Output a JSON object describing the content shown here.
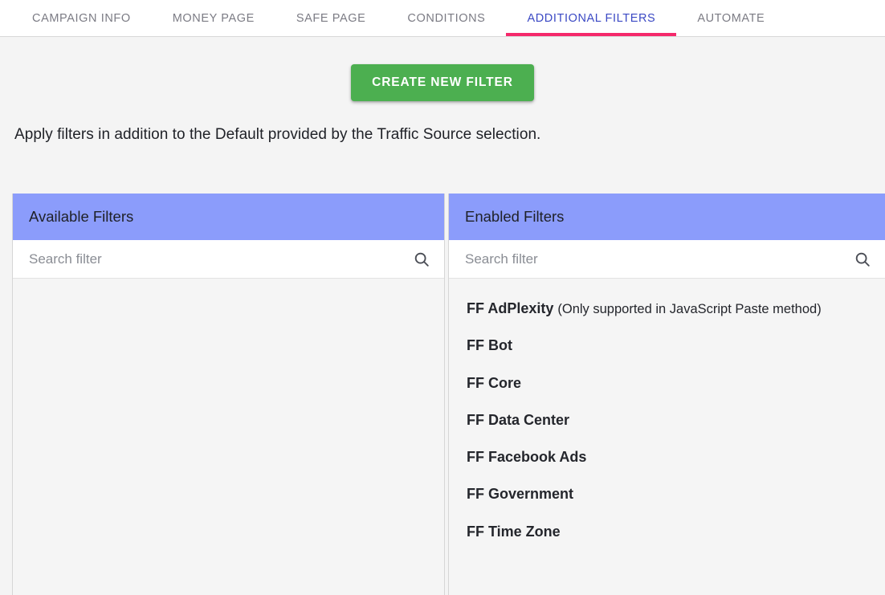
{
  "tabs": [
    {
      "label": "CAMPAIGN INFO",
      "active": false
    },
    {
      "label": "MONEY PAGE",
      "active": false
    },
    {
      "label": "SAFE PAGE",
      "active": false
    },
    {
      "label": "CONDITIONS",
      "active": false
    },
    {
      "label": "ADDITIONAL FILTERS",
      "active": true
    },
    {
      "label": "AUTOMATE",
      "active": false
    }
  ],
  "toolbar": {
    "create_filter_label": "CREATE NEW FILTER"
  },
  "description": "Apply filters in addition to the Default provided by the Traffic Source selection.",
  "panels": {
    "available": {
      "title": "Available Filters",
      "search_placeholder": "Search filter",
      "search_value": "",
      "search_icon": "search-icon",
      "items": []
    },
    "enabled": {
      "title": "Enabled Filters",
      "search_placeholder": "Search filter",
      "search_value": "",
      "search_icon": "search-icon",
      "items": [
        {
          "name": "FF AdPlexity",
          "note": "(Only supported in JavaScript Paste method)"
        },
        {
          "name": "FF Bot",
          "note": ""
        },
        {
          "name": "FF Core",
          "note": ""
        },
        {
          "name": "FF Data Center",
          "note": ""
        },
        {
          "name": "FF Facebook Ads",
          "note": ""
        },
        {
          "name": "FF Government",
          "note": ""
        },
        {
          "name": "FF Time Zone",
          "note": ""
        }
      ]
    }
  },
  "colors": {
    "accent_tab": "#3b49c4",
    "accent_underline": "#f5296b",
    "panel_header": "#8b9cfb",
    "button_green": "#4caf50",
    "page_bg": "#f4f4f4"
  }
}
